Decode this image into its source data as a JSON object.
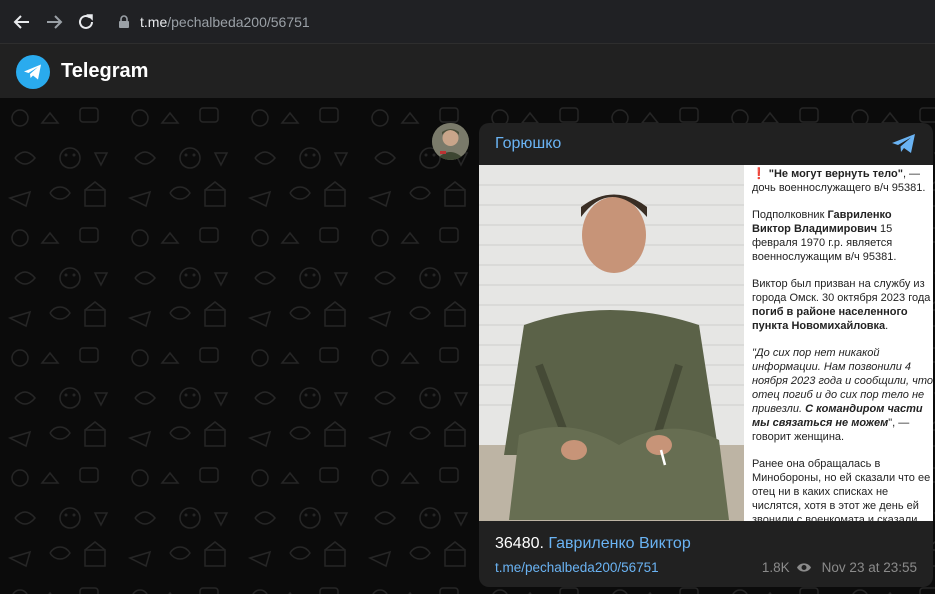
{
  "browser": {
    "url_host": "t.me",
    "url_path": "/pechalbeda200/56751"
  },
  "header": {
    "app_title": "Telegram"
  },
  "message": {
    "channel_name": "Горюшко",
    "post_text": {
      "line1_flag": "❗",
      "line1_bold": "\"Не могут вернуть тело\"",
      "line1_rest": ", — дочь военнослужащего в/ч 95381.",
      "p2_a": "Подполковник ",
      "p2_bold": "Гавриленко Виктор Владимирович",
      "p2_b": " 15 февраля 1970 г.р. является военнослужащим в/ч 95381.",
      "p3_a": "Виктор был призван на службу из города Омск. 30 октября 2023 года ",
      "p3_bold": "погиб в районе населенного пункта Новомихайловка",
      "p3_b": ".",
      "p4_italic": "\"До сих пор нет никакой информации. Нам позвонили 4 ноября 2023 года и сообщили, что отец погиб и до сих пор тело не привезли. ",
      "p4_bold_italic": "С командиром части мы связаться не можем",
      "p4_tail": "\", — говорит женщина.",
      "p5": "Ранее она обращалась в Минобороны, но ей сказали что ее отец ни в каких списках не числятся, хотя в этот же день ей звонили с военкомата и сказали,"
    },
    "caption_number": "36480.",
    "caption_name": "Гавриленко Виктор",
    "post_link": "t.me/pechalbeda200/56751",
    "views": "1.8K",
    "timestamp": "Nov 23 at 23:55"
  },
  "colors": {
    "accent": "#6ab3f3",
    "telegram_blue": "#2aabee",
    "card_bg": "#212121",
    "chat_bg": "#0b0b0b"
  },
  "icons": [
    "back-arrow-icon",
    "forward-arrow-icon",
    "reload-icon",
    "lock-icon",
    "telegram-logo-icon",
    "share-telegram-icon",
    "eye-icon"
  ]
}
